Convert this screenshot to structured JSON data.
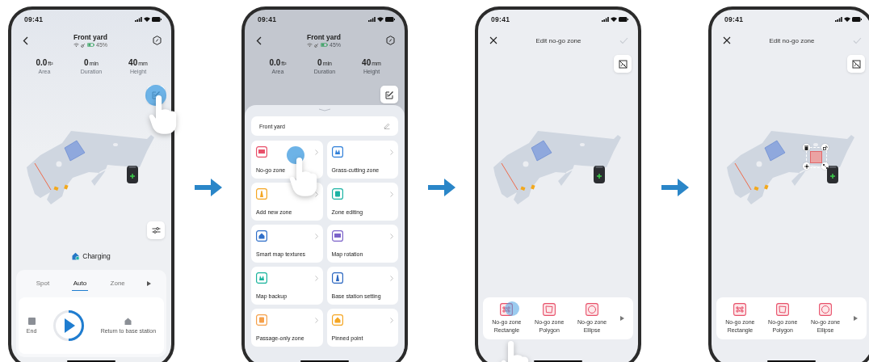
{
  "screens": [
    {
      "kind": "home",
      "time": "09:41",
      "title": "Front yard",
      "battery": "45%",
      "stats": [
        {
          "value": "0.0",
          "unit": "ft²",
          "label": "Area"
        },
        {
          "value": "0",
          "unit": "min",
          "label": "Duration"
        },
        {
          "value": "40",
          "unit": "mm",
          "label": "Height"
        }
      ],
      "status": "Charging",
      "modes": [
        {
          "label": "Spot",
          "selected": false
        },
        {
          "label": "Auto",
          "selected": true
        },
        {
          "label": "Zone",
          "selected": false
        }
      ],
      "controls": [
        {
          "label": "End"
        },
        {
          "label": "Return to base station"
        }
      ]
    },
    {
      "kind": "menu",
      "time": "09:41",
      "title": "Front yard",
      "battery": "45%",
      "stats": [
        {
          "value": "0.0",
          "unit": "ft²",
          "label": "Area"
        },
        {
          "value": "0",
          "unit": "min",
          "label": "Duration"
        },
        {
          "value": "40",
          "unit": "mm",
          "label": "Height"
        }
      ],
      "map_name": "Front yard",
      "items": [
        {
          "label": "No-go zone",
          "color": "#e8506a"
        },
        {
          "label": "Grass-cutting zone",
          "color": "#2f7fd8"
        },
        {
          "label": "Add new zone",
          "color": "#f5a623"
        },
        {
          "label": "Zone editing",
          "color": "#1bb3a4"
        },
        {
          "label": "Smart map textures",
          "color": "#2f6fc9"
        },
        {
          "label": "Map rotation",
          "color": "#7b62c9"
        },
        {
          "label": "Map backup",
          "color": "#19b39c"
        },
        {
          "label": "Base station setting",
          "color": "#2a66c0"
        },
        {
          "label": "Passage-only zone",
          "color": "#f5a04a"
        },
        {
          "label": "Pinned point",
          "color": "#f5a623"
        }
      ]
    },
    {
      "kind": "editor",
      "time": "09:41",
      "title": "Edit no-go zone",
      "zone_placed": false,
      "options": [
        {
          "name": "No-go zone",
          "shape": "Rectangle"
        },
        {
          "name": "No-go zone",
          "shape": "Polygon"
        },
        {
          "name": "No-go zone",
          "shape": "Ellipse"
        }
      ]
    },
    {
      "kind": "editor",
      "time": "09:41",
      "title": "Edit no-go zone",
      "zone_placed": true,
      "options": [
        {
          "name": "No-go zone",
          "shape": "Rectangle"
        },
        {
          "name": "No-go zone",
          "shape": "Polygon"
        },
        {
          "name": "No-go zone",
          "shape": "Ellipse"
        }
      ]
    }
  ]
}
